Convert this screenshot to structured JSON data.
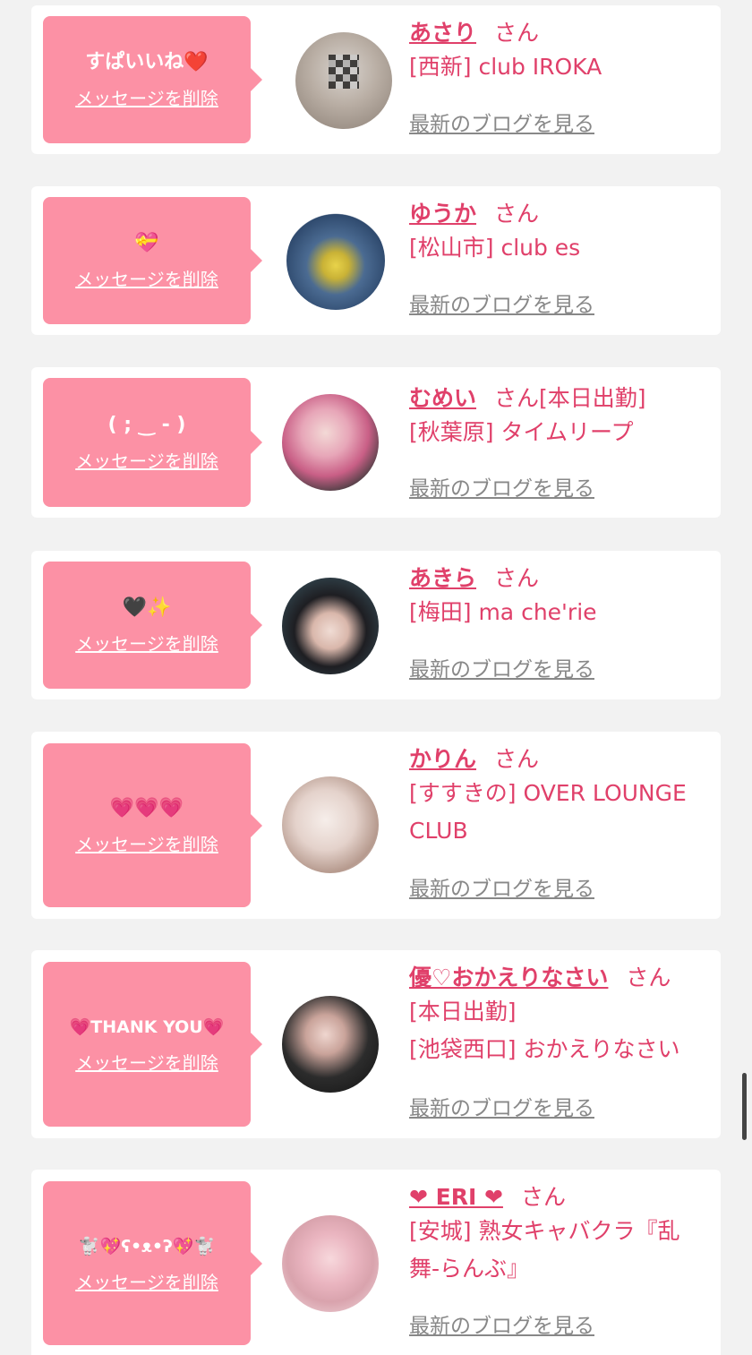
{
  "colors": {
    "page_bg": "#f2f2f2",
    "card_bg": "#ffffff",
    "bubble_bg": "#fc91a5",
    "accent": "#e0406a",
    "link_gray": "#888888"
  },
  "common": {
    "delete_label": "メッセージを削除",
    "san": "さん",
    "blog_label": "最新のブログを見る"
  },
  "items": [
    {
      "message": "すぱいいね❤️",
      "name": "あさり",
      "shop": "[西新] club IROKA",
      "avatar_icon": "avatar-photo"
    },
    {
      "message": "💝",
      "name": "ゆうか",
      "shop": "[松山市] club es",
      "avatar_icon": "avatar-photo"
    },
    {
      "message": "( ; ‿ - )",
      "name": "むめい",
      "name_suffix": "[本日出勤]",
      "shop": "[秋葉原] タイムリープ",
      "avatar_icon": "avatar-photo"
    },
    {
      "message": "🖤✨",
      "name": "あきら",
      "shop": "[梅田] ma che'rie",
      "avatar_icon": "avatar-photo"
    },
    {
      "message": "💗💗💗",
      "name": "かりん",
      "shop": "[すすきの] OVER LOUNGE CLUB",
      "avatar_icon": "avatar-photo"
    },
    {
      "message": "💗THANK YOU💗",
      "name": "優♡おかえりなさい",
      "shop_line1": "[本日出勤]",
      "shop": "[池袋西口] おかえりなさい",
      "avatar_icon": "avatar-photo"
    },
    {
      "message": "🐩💖ʕ•ᴥ•ʔ💖🐩",
      "name": "❤ ERI ❤",
      "shop": "[安城] 熟女キャバクラ『乱舞-らんぶ』",
      "avatar_icon": "avatar-photo"
    }
  ]
}
